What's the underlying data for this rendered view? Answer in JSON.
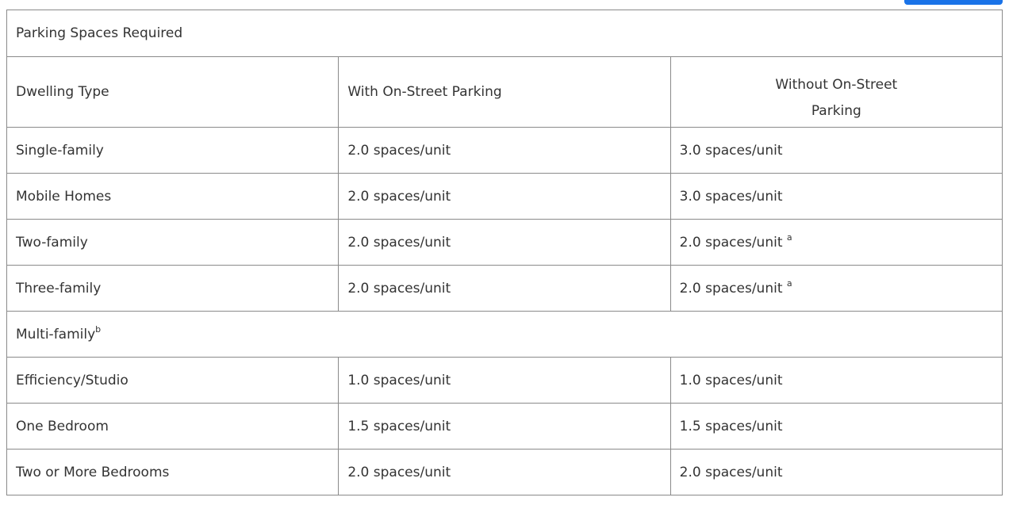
{
  "caption": "Parking Spaces Required",
  "headers": {
    "dwelling_type": "Dwelling Type",
    "with_on_street": "With On-Street Parking",
    "without_on_street_line1": "Without On-Street",
    "without_on_street_line2": "Parking"
  },
  "rows": [
    {
      "type": "Single-family",
      "with": "2.0 spaces/unit",
      "without": "3.0 spaces/unit",
      "note": ""
    },
    {
      "type": "Mobile Homes",
      "with": "2.0 spaces/unit",
      "without": "3.0 spaces/unit",
      "note": ""
    },
    {
      "type": "Two-family",
      "with": "2.0 spaces/unit",
      "without": "2.0 spaces/unit",
      "note": "a"
    },
    {
      "type": "Three-family",
      "with": "2.0 spaces/unit",
      "without": "2.0 spaces/unit",
      "note": "a"
    }
  ],
  "multi_family": {
    "label": "Multi-family",
    "note": "b",
    "rows": [
      {
        "type": "Efficiency/Studio",
        "with": "1.0 spaces/unit",
        "without": "1.0 spaces/unit"
      },
      {
        "type": "One Bedroom",
        "with": "1.5 spaces/unit",
        "without": "1.5 spaces/unit"
      },
      {
        "type": "Two or More Bedrooms",
        "with": "2.0 spaces/unit",
        "without": "2.0 spaces/unit"
      }
    ]
  },
  "colors": {
    "top_button": "#1a73e8",
    "border": "#8a8a8a",
    "text": "#333333"
  }
}
